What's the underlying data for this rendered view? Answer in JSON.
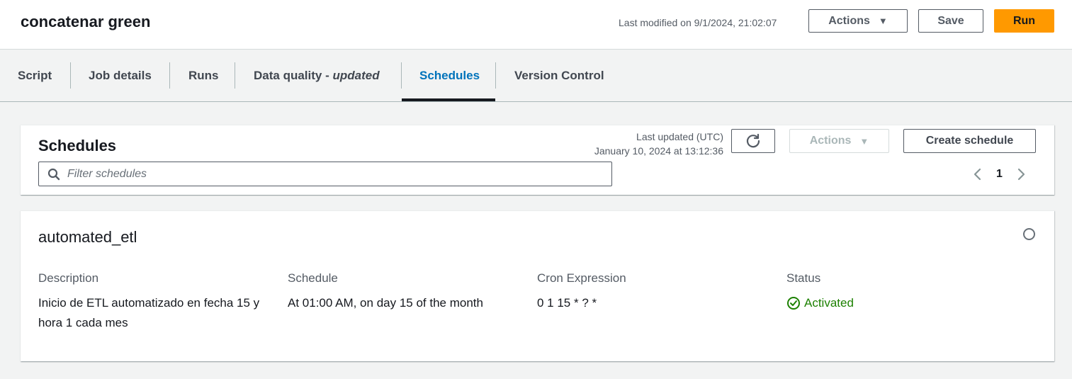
{
  "header": {
    "job_title": "concatenar green",
    "last_modified": "Last modified on 9/1/2024, 21:02:07",
    "actions_label": "Actions",
    "save_label": "Save",
    "run_label": "Run"
  },
  "tabs": [
    {
      "label": "Script"
    },
    {
      "label": "Job details"
    },
    {
      "label": "Runs"
    },
    {
      "label": "Data quality - ",
      "suffix": "updated"
    },
    {
      "label": "Schedules",
      "active": true
    },
    {
      "label": "Version Control"
    }
  ],
  "schedules_panel": {
    "title": "Schedules",
    "last_updated_label": "Last updated (UTC)",
    "last_updated_value": "January 10, 2024 at 13:12:36",
    "actions_label": "Actions",
    "create_label": "Create schedule",
    "filter_placeholder": "Filter schedules",
    "page": "1"
  },
  "schedule": {
    "name": "automated_etl",
    "description_label": "Description",
    "description_value": "Inicio de ETL automatizado en fecha 15 y hora 1 cada mes",
    "schedule_label": "Schedule",
    "schedule_value": "At 01:00 AM, on day 15 of the month",
    "cron_label": "Cron Expression",
    "cron_value": "0 1 15 * ? *",
    "status_label": "Status",
    "status_value": "Activated"
  },
  "colors": {
    "accent": "#0073bb",
    "run_button": "#ff9900",
    "status_success": "#1d8102"
  }
}
